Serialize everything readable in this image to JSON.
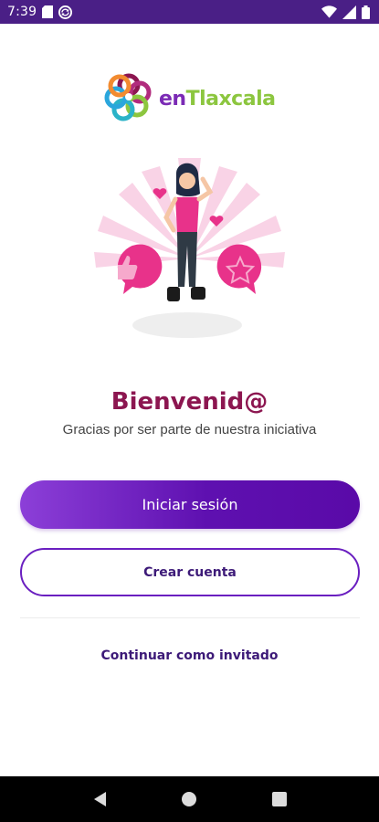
{
  "status_bar": {
    "time": "7:39",
    "left_icons": [
      "sd-card-icon",
      "sync-icon"
    ],
    "right_icons": [
      "wifi-icon",
      "signal-icon",
      "battery-icon"
    ],
    "background": "#4a1f86"
  },
  "logo": {
    "text_en": "en",
    "text_rest": "Tlaxcala",
    "colors": {
      "en": "#7b2bb5",
      "rest": "#8cc63f"
    }
  },
  "welcome": {
    "title": "Bienvenid@",
    "subtitle": "Gracias por ser parte de nuestra iniciativa"
  },
  "actions": {
    "login_label": "Iniciar sesión",
    "register_label": "Crear cuenta",
    "guest_label": "Continuar como invitado"
  },
  "nav_bar": {
    "buttons": [
      "back-icon",
      "home-icon",
      "recents-icon"
    ]
  },
  "colors": {
    "primary": "#5e10b0",
    "primary_light": "#8c3fd8",
    "title": "#8c1650",
    "accent_pink": "#e8328a"
  }
}
